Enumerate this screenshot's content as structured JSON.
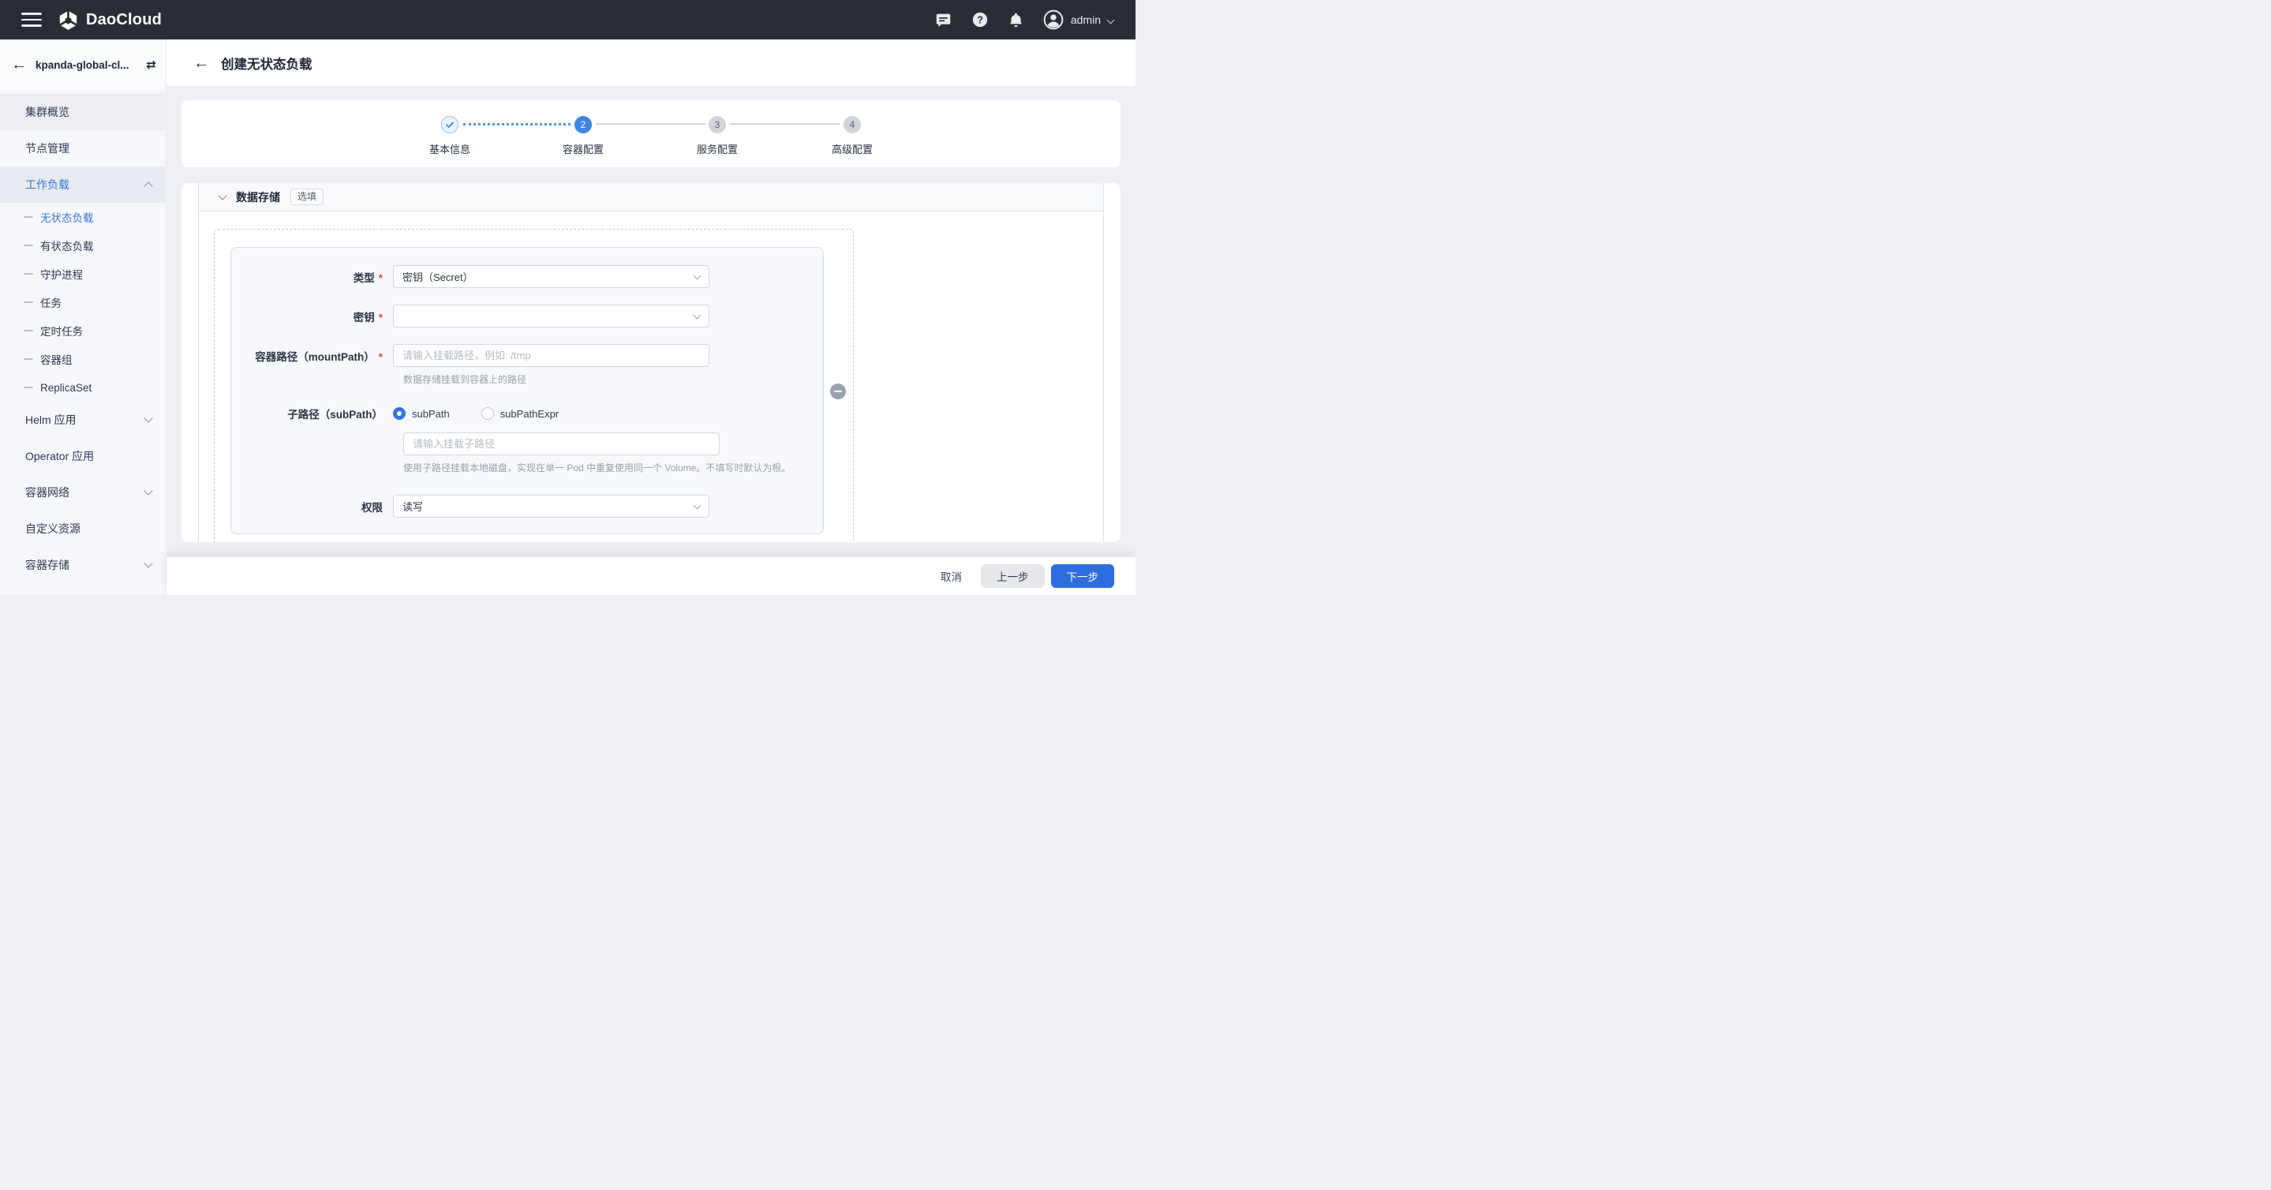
{
  "colors": {
    "accent": "#2f6cdf",
    "topbar_bg": "#2a2d35",
    "sidebar_active": "#3a75dc"
  },
  "topbar": {
    "brand": "DaoCloud",
    "user": "admin"
  },
  "sidebar": {
    "cluster": "kpanda-global-cl...",
    "items": [
      {
        "label": "集群概览"
      },
      {
        "label": "节点管理"
      },
      {
        "label": "工作负载"
      },
      {
        "label": "无状态负载"
      },
      {
        "label": "有状态负载"
      },
      {
        "label": "守护进程"
      },
      {
        "label": "任务"
      },
      {
        "label": "定时任务"
      },
      {
        "label": "容器组"
      },
      {
        "label": "ReplicaSet"
      },
      {
        "label": "Helm 应用"
      },
      {
        "label": "Operator 应用"
      },
      {
        "label": "容器网络"
      },
      {
        "label": "自定义资源"
      },
      {
        "label": "容器存储"
      }
    ]
  },
  "page": {
    "title": "创建无状态负载"
  },
  "stepper": {
    "steps": [
      {
        "num": "1",
        "label": "基本信息",
        "state": "done"
      },
      {
        "num": "2",
        "label": "容器配置",
        "state": "active"
      },
      {
        "num": "3",
        "label": "服务配置",
        "state": "wait"
      },
      {
        "num": "4",
        "label": "高级配置",
        "state": "wait"
      }
    ]
  },
  "section": {
    "title": "数据存储",
    "badge": "选填"
  },
  "form": {
    "type": {
      "label": "类型",
      "value": "密钥（Secret）"
    },
    "secret": {
      "label": "密钥",
      "value": ""
    },
    "mount": {
      "label": "容器路径（mountPath）",
      "placeholder": "请输入挂载路径，例如: /tmp",
      "help": "数据存储挂载到容器上的路径"
    },
    "subpath": {
      "label": "子路径（subPath）",
      "option1": "subPath",
      "option2": "subPathExpr",
      "selected": "subPath",
      "placeholder": "请输入挂载子路径",
      "help": "使用子路径挂载本地磁盘，实现在单一 Pod 中重复使用同一个 Volume。不填写时默认为根。"
    },
    "perm": {
      "label": "权限",
      "value": "读写"
    }
  },
  "footer": {
    "cancel": "取消",
    "prev": "上一步",
    "next": "下一步"
  }
}
